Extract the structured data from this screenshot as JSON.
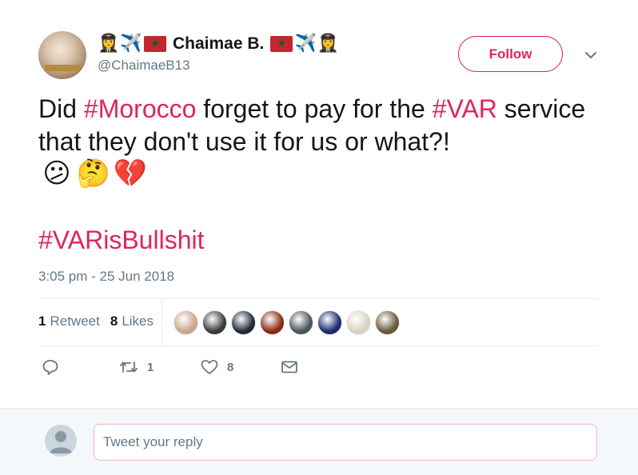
{
  "author": {
    "display_name": "Chaimae B.",
    "handle": "@ChaimaeB13",
    "name_emoji_left": [
      "👩‍✈️",
      "✈️"
    ],
    "name_emoji_right": [
      "✈️",
      "👩‍✈️"
    ],
    "avatar_icon": "profile-photo"
  },
  "follow_button": {
    "label": "Follow"
  },
  "tweet": {
    "text_parts": {
      "p1": "Did ",
      "tag1": "#Morocco",
      "p2": " forget to pay for the ",
      "tag2": "#VAR",
      "p3": " service that they don't use it for us or what?!"
    },
    "emojis": [
      "😕",
      "🤔",
      "💔"
    ],
    "hashtag_line": "#VARisBullshit",
    "timestamp": "3:05 pm - 25 Jun 2018"
  },
  "stats": {
    "retweets_count": "1",
    "retweets_label": "Retweet",
    "likes_count": "8",
    "likes_label": "Likes"
  },
  "likers": [
    {
      "color": "#c9a48a"
    },
    {
      "color": "#3a3a3a"
    },
    {
      "color": "#1f2a36"
    },
    {
      "color": "#8a2a14"
    },
    {
      "color": "#4a5560"
    },
    {
      "color": "#1a2b6e"
    },
    {
      "color": "#d9d2c0"
    },
    {
      "color": "#6b5a3a"
    }
  ],
  "actions": {
    "reply_icon": "reply-icon",
    "retweet_count": "1",
    "like_count": "8",
    "message_icon": "envelope-icon"
  },
  "reply": {
    "placeholder": "Tweet your reply"
  },
  "colors": {
    "accent": "#e0245e",
    "muted": "#657786",
    "text": "#14171a",
    "divider": "#e6ecf0"
  }
}
